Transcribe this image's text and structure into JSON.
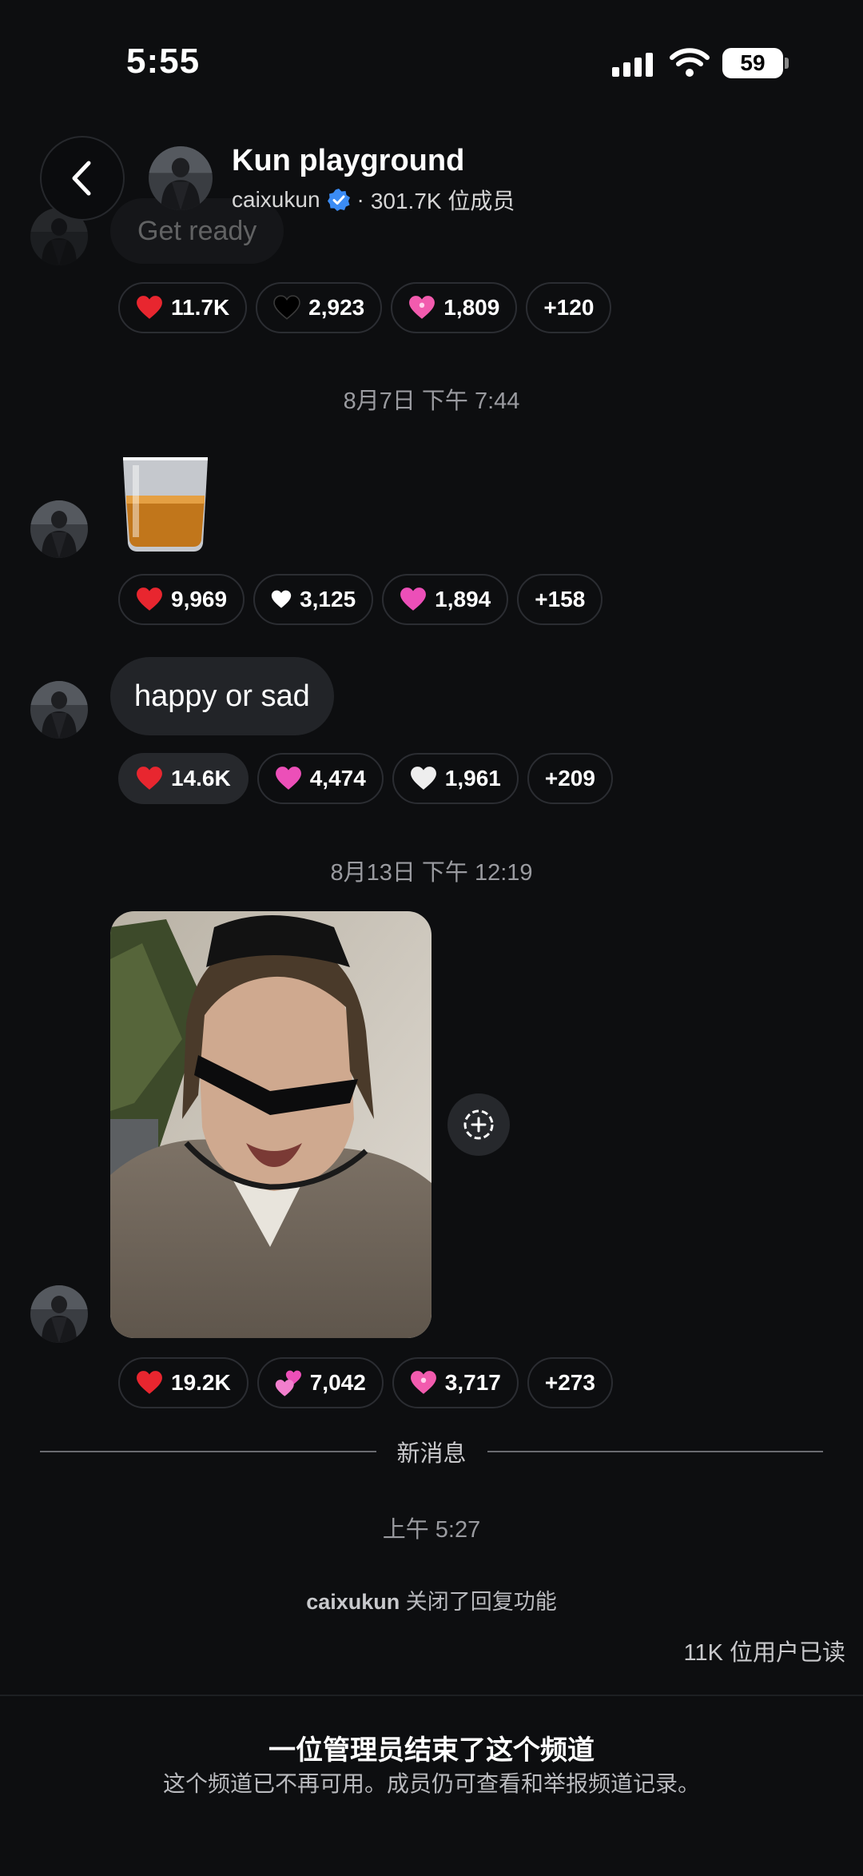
{
  "status_bar": {
    "time": "5:55",
    "battery": "59"
  },
  "header": {
    "title": "Kun playground",
    "username": "caixukun",
    "separator": "·",
    "members": "301.7K 位成员"
  },
  "previous_message": {
    "text": "Get ready"
  },
  "reactions_1": [
    {
      "emoji": "red-heart",
      "count": "11.7K"
    },
    {
      "emoji": "black-heart",
      "count": "2,923"
    },
    {
      "emoji": "sparkling-heart",
      "count": "1,809"
    },
    {
      "more": "+120"
    }
  ],
  "timestamp_1": "8月7日 下午 7:44",
  "emoji_message": {
    "icon": "tumbler-glass-emoji"
  },
  "reactions_2": [
    {
      "emoji": "red-heart",
      "count": "9,969"
    },
    {
      "emoji": "white-heart",
      "count": "3,125"
    },
    {
      "emoji": "pink-heart",
      "count": "1,894"
    },
    {
      "more": "+158"
    }
  ],
  "text_message": {
    "text": "happy or sad"
  },
  "reactions_3": [
    {
      "emoji": "red-heart",
      "count": "14.6K",
      "selected": true
    },
    {
      "emoji": "pink-heart",
      "count": "4,474"
    },
    {
      "emoji": "white-heart",
      "count": "1,961"
    },
    {
      "more": "+209"
    }
  ],
  "timestamp_2": "8月13日 下午 12:19",
  "reactions_4": [
    {
      "emoji": "red-heart",
      "count": "19.2K"
    },
    {
      "emoji": "two-hearts",
      "count": "7,042"
    },
    {
      "emoji": "sparkling-heart",
      "count": "3,717"
    },
    {
      "more": "+273"
    }
  ],
  "new_messages_label": "新消息",
  "system_time": "上午 5:27",
  "system_message": {
    "user": "caixukun",
    "text": " 关闭了回复功能"
  },
  "read_count": "11K 位用户已读",
  "channel_ended": {
    "title": "一位管理员结束了这个频道",
    "subtitle": "这个频道已不再可用。成员仍可查看和举报频道记录。"
  },
  "colors": {
    "background": "#0d0e10",
    "pill_border": "#2b2d32",
    "bubble": "#222428",
    "verified": "#3b8cf5",
    "muted_text": "#9a9ba0"
  }
}
